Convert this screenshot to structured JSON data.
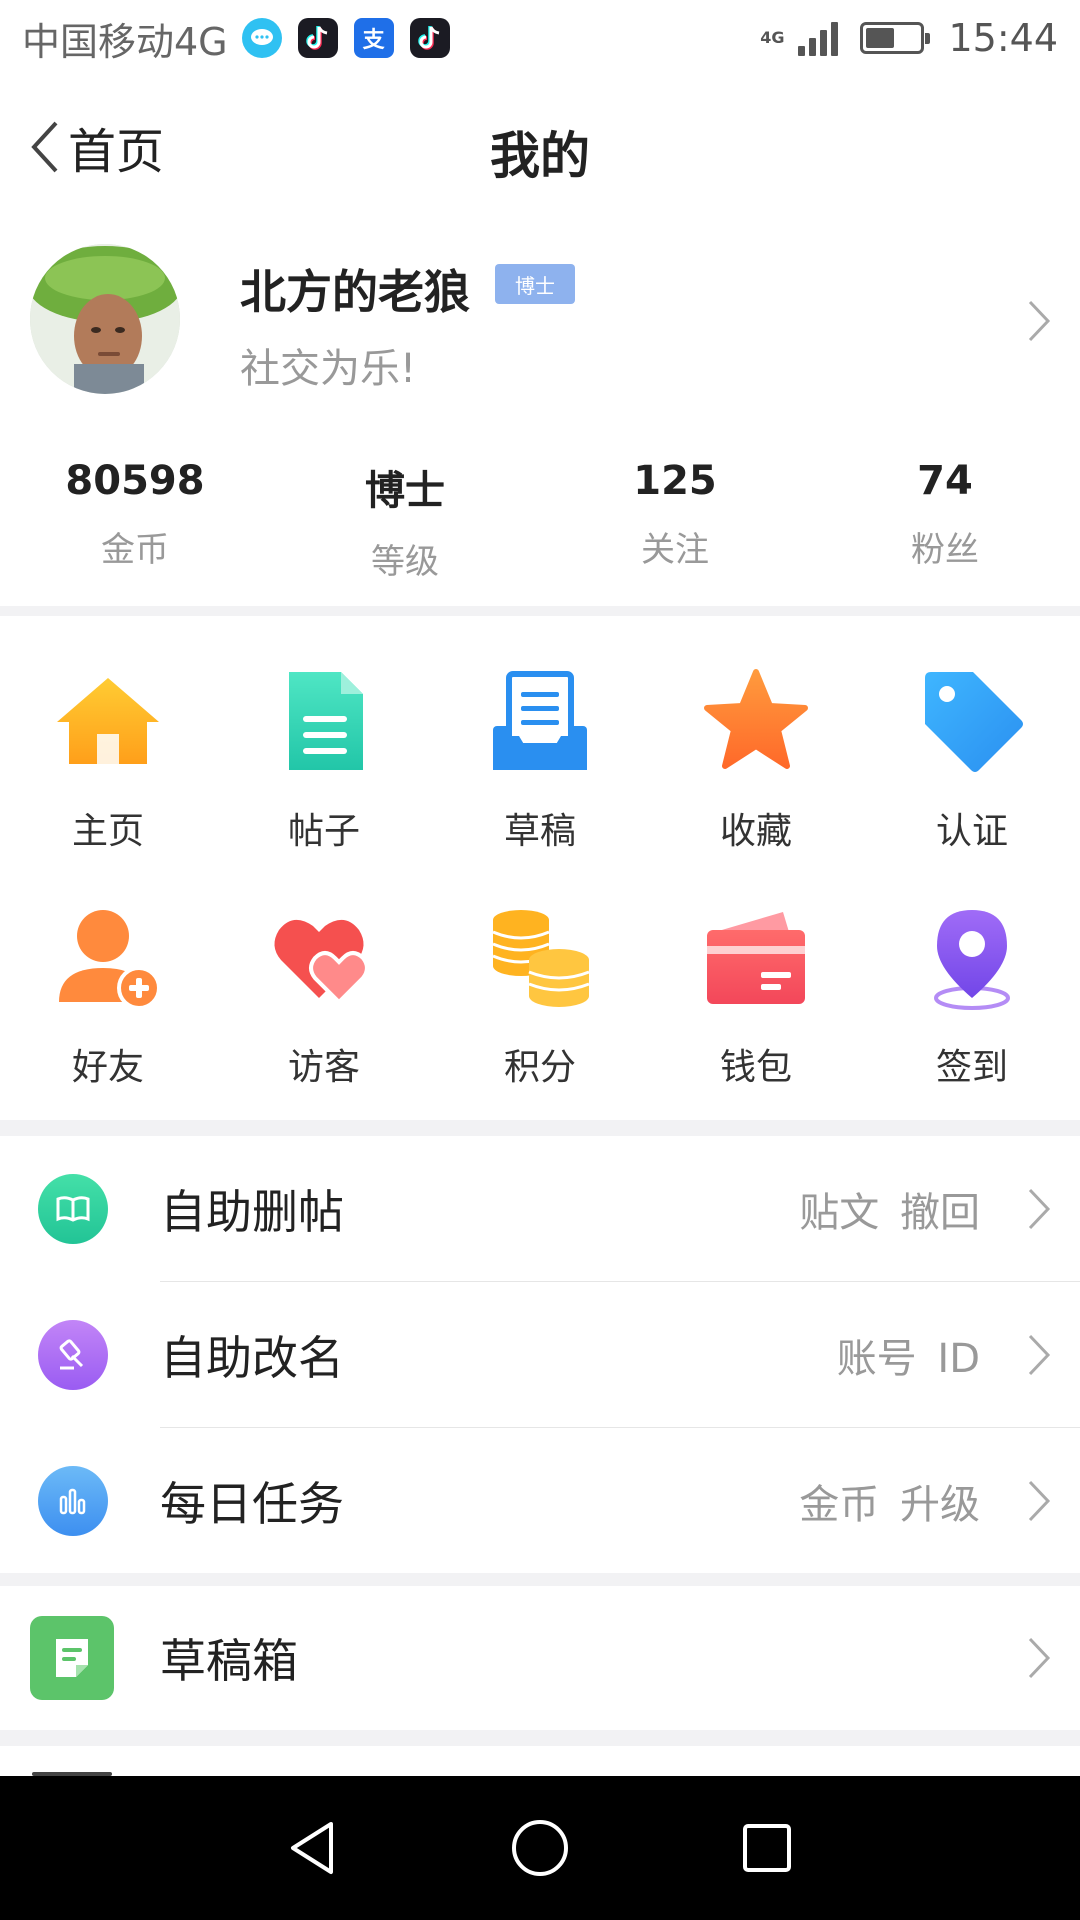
{
  "status_bar": {
    "carrier": "中国移动4G",
    "network": "4G",
    "time": "15:44",
    "notification_icons": [
      "chat-bubble-icon",
      "tiktok-icon",
      "alipay-icon",
      "tiktok-icon"
    ],
    "alipay_glyph": "支"
  },
  "header": {
    "back_label": "首页",
    "title": "我的"
  },
  "profile": {
    "username": "北方的老狼",
    "badge": "博士",
    "signature": "社交为乐!"
  },
  "stats": [
    {
      "value": "80598",
      "label": "金币"
    },
    {
      "value": "博士",
      "label": "等级"
    },
    {
      "value": "125",
      "label": "关注"
    },
    {
      "value": "74",
      "label": "粉丝"
    }
  ],
  "grid": [
    {
      "label": "主页",
      "icon": "house-icon",
      "color": "#ffb020"
    },
    {
      "label": "帖子",
      "icon": "document-icon",
      "color": "#2fd4b0"
    },
    {
      "label": "草稿",
      "icon": "draft-tray-icon",
      "color": "#2a8ff0"
    },
    {
      "label": "收藏",
      "icon": "star-icon",
      "color": "#ff7a30"
    },
    {
      "label": "认证",
      "icon": "tag-icon",
      "color": "#2f9af5"
    },
    {
      "label": "好友",
      "icon": "add-friend-icon",
      "color": "#ff8a3d"
    },
    {
      "label": "访客",
      "icon": "hearts-icon",
      "color": "#f5504f"
    },
    {
      "label": "积分",
      "icon": "coins-icon",
      "color": "#ffb320"
    },
    {
      "label": "钱包",
      "icon": "wallet-icon",
      "color": "#f3475a"
    },
    {
      "label": "签到",
      "icon": "location-pin-icon",
      "color": "#8a5cf5"
    }
  ],
  "list_main": [
    {
      "title": "自助删帖",
      "sub": "贴文 撤回",
      "icon": "book-icon",
      "color": "#2fd4a0"
    },
    {
      "title": "自助改名",
      "sub": "账号 ID",
      "icon": "gavel-icon",
      "color": "#a86ef5"
    },
    {
      "title": "每日任务",
      "sub": "金币 升级",
      "icon": "bar-chart-icon",
      "color": "#4aa3f5"
    }
  ],
  "list_drafts": [
    {
      "title": "草稿箱",
      "icon": "draft-box-icon",
      "color": "#5cc46a"
    }
  ],
  "navbar": {
    "icons": [
      "back-triangle-icon",
      "home-circle-icon",
      "recents-square-icon"
    ]
  }
}
